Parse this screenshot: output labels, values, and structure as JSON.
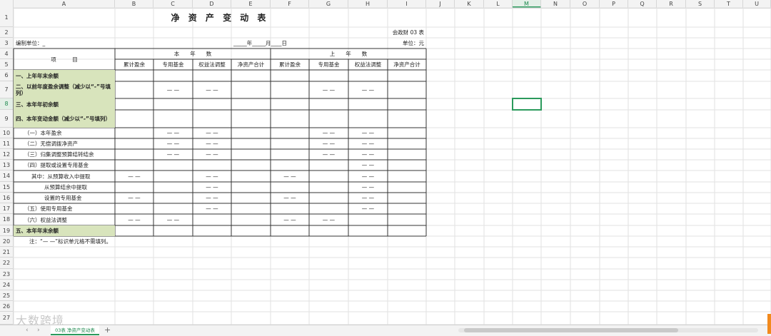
{
  "columns": [
    "A",
    "B",
    "C",
    "D",
    "E",
    "F",
    "G",
    "H",
    "I",
    "J",
    "K",
    "L",
    "M",
    "N",
    "O",
    "P",
    "Q",
    "R",
    "S",
    "T",
    "U"
  ],
  "active_column": "M",
  "active_row": "8",
  "rows": [
    "1",
    "2",
    "3",
    "4",
    "5",
    "6",
    "7",
    "8",
    "9",
    "10",
    "11",
    "12",
    "13",
    "14",
    "15",
    "16",
    "17",
    "18",
    "19",
    "20",
    "21",
    "22",
    "23",
    "24",
    "25",
    "26",
    "27"
  ],
  "sheet": {
    "title": "净 资 产 变 动 表",
    "form_code": "会政财 03 表",
    "entity_label": "编制单位：_",
    "date_text": "_____年_____月____日",
    "unit": "单位：元",
    "item_header": "项　　　目",
    "this_year": "本　　年　　数",
    "last_year": "上　　年　　数",
    "subcols": [
      "累计盈余",
      "专用基金",
      "权益法调整",
      "净资产合计",
      "累计盈余",
      "专用基金",
      "权益法调整",
      "净资产合计"
    ],
    "dash": "— —",
    "items": [
      "一、上年年末余额",
      "二、以前年度盈余调整（减少以“-”号填列）",
      "三、本年年初余额",
      "四、本年变动金额（减少以“-”号填列）",
      "（一）本年盈余",
      "（二）无偿调拨净资产",
      "（三）归集调整预算结转结余",
      "（四）提取或设置专用基金",
      "其中：从预算收入中提取",
      "从预算结余中提取",
      "设置的专用基金",
      "（五）使用专用基金",
      "（六）权益法调整",
      "五、本年年末余额"
    ],
    "note": "注：“— —”标识单元格不需填列。"
  },
  "tab_bar": {
    "sheet_name": "03表 净资产变动表",
    "add_label": "+",
    "nav_prev": "‹",
    "nav_next": "›"
  },
  "watermark": "大数跨境",
  "colors": {
    "header_green": "#d8e4bc",
    "accent": "#2b9a5c"
  }
}
